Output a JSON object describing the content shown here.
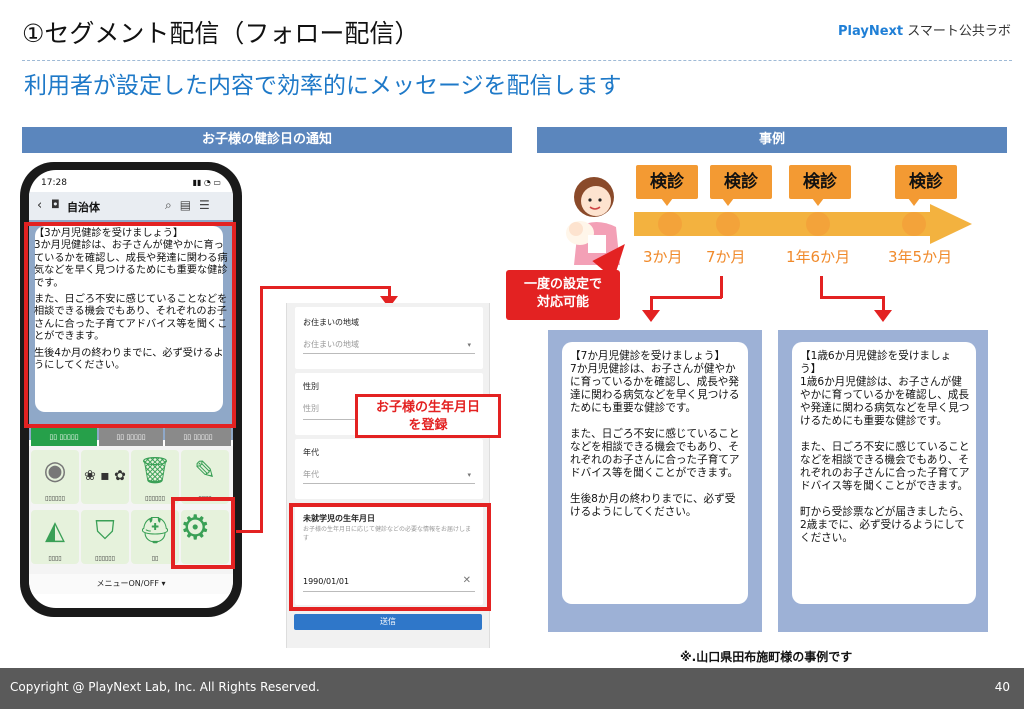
{
  "header": {
    "title": "①セグメント配信（フォロー配信）",
    "brand_play": "Play",
    "brand_next": "Next",
    "brand_rest": " スマート公共ラボ",
    "subtitle": "利用者が設定した内容で効率的にメッセージを配信します"
  },
  "left_section": {
    "heading": "お子様の健診日の通知",
    "phone": {
      "time": "17:28",
      "status_icons": "▮▮ ◔ ▭",
      "back_icon": "‹",
      "shield_icon": "◘",
      "nav_title": "自治体",
      "nav_icons": "⌕▤☰",
      "message": [
        "【3か月児健診を受けましょう】",
        "3か月児健診は、お子さんが健やかに育っているかを確認し、成長や発達に関わる病気などを早く見つけるためにも重要な健診です。",
        "また、日ごろ不安に感じていることなどを相談できる機会でもあり、それぞれのお子さんに合った子育てアドバイス等を聞くことができます。",
        "生後4か月の終わりまでに、必ず受けるようにしてください。"
      ],
      "menu_toggle": "メニューON/OFF ▾"
    },
    "form": {
      "field1_label": "お住まいの地域",
      "field1_placeholder": "お住まいの地域",
      "field2_label": "性別",
      "field2_placeholder": "性別",
      "field3_label": "年代",
      "field3_placeholder": "年代",
      "field4_label": "未就学児の生年月日",
      "field4_help": "お子様の生年月日に応じて健診などの必要な情報をお届けします",
      "field4_value": "1990/01/01",
      "clear_icon": "✕",
      "submit": "送信"
    },
    "callout": "お子様の生年月日\nを登録"
  },
  "right_section": {
    "heading": "事例",
    "timeline": [
      {
        "badge": "検診",
        "age": "3か月"
      },
      {
        "badge": "検診",
        "age": "7か月"
      },
      {
        "badge": "検診",
        "age": "1年6か月"
      },
      {
        "badge": "検診",
        "age": "3年5か月"
      }
    ],
    "callout": "一度の設定で\n対応可能",
    "card1": [
      "【7か月児健診を受けましょう】\n7か月児健診は、お子さんが健やかに育っているかを確認し、成長や発達に関わる病気などを早く見つけるためにも重要な健診です。",
      "また、日ごろ不安に感じていることなどを相談できる機会でもあり、それぞれのお子さんに合った子育てアドバイス等を聞くことができます。",
      "生後8か月の終わりまでに、必ず受けるようにしてください。"
    ],
    "card2": [
      "【1歳6か月児健診を受けましょう】\n1歳6か月児健診は、お子さんが健やかに育っているかを確認し、成長や発達に関わる病気などを早く見つけるためにも重要な健診です。",
      "また、日ごろ不安に感じていることなどを相談できる機会でもあり、それぞれのお子さんに合った子育てアドバイス等を聞くことができます。",
      "町から受診票などが届きましたら、2歳までに、必ず受けるようにしてください。"
    ],
    "footnote": "※.山口県田布施町様の事例です"
  },
  "footer": {
    "copyright": "Copyright @ PlayNext Lab, Inc. All Rights Reserved.",
    "page": "40"
  },
  "colors": {
    "accent_blue": "#1e79c8",
    "bar_blue": "#5b86bd",
    "highlight_red": "#e32222",
    "timeline_orange": "#f3a33a",
    "panel_blue": "#9db1d6"
  }
}
